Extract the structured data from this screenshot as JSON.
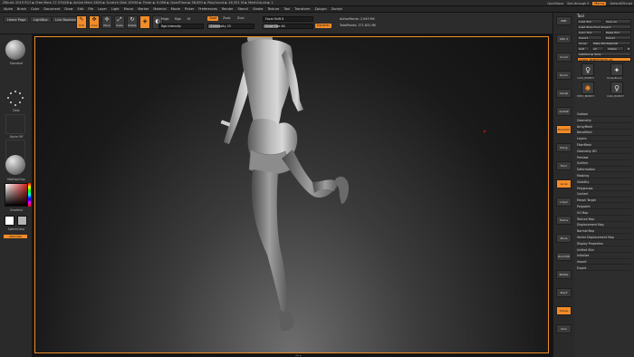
{
  "titlebar": {
    "title": "ZBrush 2019   R12   ► Free Mem 17.574GB ► Active Mem 2624 ► Scratch Disk 10934 ► Timer ► 0.066 ► QuadTime ► 58,891 ► PolyCount ► 16,351 M ► MeshCount ► 1",
    "items": [
      "QuickSave",
      "See-through 0",
      "Menus",
      "DefaultZScript"
    ]
  },
  "menubar": [
    "Alpha",
    "Brush",
    "Color",
    "Document",
    "Draw",
    "Edit",
    "File",
    "Layer",
    "Light",
    "Macro",
    "Marker",
    "Material",
    "Movie",
    "Picker",
    "Preferences",
    "Render",
    "Stencil",
    "Stroke",
    "Texture",
    "Tool",
    "Transform",
    "Zplugin",
    "Zscript"
  ],
  "shelf": {
    "home_page": "Home Page",
    "lightbox": "LightBox",
    "live_boolean": "Live Boolean",
    "tools": [
      {
        "icon": "edit-icon",
        "glyph": "✎",
        "label": "Edit",
        "active": true
      },
      {
        "icon": "draw-icon",
        "glyph": "✥",
        "label": "Draw",
        "active": true
      },
      {
        "icon": "move-icon",
        "glyph": "✢",
        "label": "Move",
        "active": false
      },
      {
        "icon": "scale-icon",
        "glyph": "⤢",
        "label": "Scale",
        "active": false
      },
      {
        "icon": "rotate-icon",
        "glyph": "↻",
        "label": "Rotate",
        "active": false
      },
      {
        "icon": "gizmo-icon",
        "glyph": "◈",
        "label": "",
        "active": true
      },
      {
        "icon": "sphere-icon",
        "glyph": "◐",
        "label": "",
        "active": false
      }
    ],
    "mrgb": "Mrgb",
    "rgb": "Rgb",
    "m": "M",
    "zadd": "Zadd",
    "zsub": "Zsub",
    "zcut": "Zcut",
    "rgb_intensity": "Rgb Intensity",
    "z_intensity": "Z Intensity 25",
    "z_intensity_value": 0.25,
    "focal_shift": "Focal Shift 0",
    "draw_size": "Draw Size 64",
    "active_points": "ActivePoints: 2,949 Mil",
    "total_points": "TotalPoints: 271.831 Mil",
    "dynamic": "Dynamic"
  },
  "leftpanel": {
    "standard": "Standard",
    "dots": "Dots",
    "alpha_off": "Alpha Off",
    "texture_off": "Texture Off",
    "matcap": "MatCapGray",
    "gradient": "Gradient",
    "switch_color": "SwitchColor",
    "alternate": "Alternate",
    "fg_color": "#ffffff",
    "bg_color": "#b4b4b4"
  },
  "canvas": {
    "footer": "◂ ▸ ▴"
  },
  "right_strip": [
    {
      "label": "BPR",
      "orange": false
    },
    {
      "label": "SPix 3",
      "orange": false
    },
    {
      "label": "Scroll",
      "orange": false
    },
    {
      "label": "Zoom",
      "orange": false
    },
    {
      "label": "Actual",
      "orange": false
    },
    {
      "label": "AAHalf",
      "orange": false
    },
    {
      "label": "Dynamic",
      "orange": true
    },
    {
      "label": "Persp",
      "orange": false
    },
    {
      "label": "Floor",
      "orange": false
    },
    {
      "label": "Local",
      "orange": true
    },
    {
      "label": "L.Sym",
      "orange": false
    },
    {
      "label": "Frame",
      "orange": false
    },
    {
      "label": "Move",
      "orange": false
    },
    {
      "label": "Zoom3D",
      "orange": false
    },
    {
      "label": "Rotate",
      "orange": false
    },
    {
      "label": "PolyF",
      "orange": false
    },
    {
      "label": "Transp",
      "orange": true
    },
    {
      "label": "Solo",
      "orange": false
    }
  ],
  "rightpanel": {
    "title": "Tool",
    "buttons": [
      "Load Tool",
      "Save As",
      "Load Tools From Project",
      "Copy Tool",
      "Paste Tool",
      "Import",
      "Export",
      "Clone",
      "Make PolyMesh3D",
      "GoZ",
      "All",
      "Visible",
      "R",
      "Lightbox ► Tools",
      "CLOGS_BKNEXTNCHG 48"
    ],
    "thumbs": [
      {
        "glyph": "♀",
        "label": "CLOD_BKNEXT"
      },
      {
        "glyph": "✦",
        "label": "SimpleBrush"
      },
      {
        "glyph": "✺",
        "label": "PM3D_BKNEXT"
      },
      {
        "glyph": "♀",
        "label": "CLOG_BKNEXT"
      }
    ],
    "subpalettes": [
      "Subtool",
      "Geometry",
      "ArrayMesh",
      "NanoMesh",
      "Layers",
      "FiberMesh",
      "Geometry HD",
      "Preview",
      "Surface",
      "Deformation",
      "Masking",
      "Visibility",
      "Polygroups",
      "Contact",
      "Morph Target",
      "Polypaint",
      "UV Map",
      "Texture Map",
      "Displacement Map",
      "Normal Map",
      "Vector Displacement Map",
      "Display Properties",
      "Unified Skin",
      "Initialize",
      "Import",
      "Export"
    ]
  },
  "colors": {
    "accent": "#f28c28",
    "panel": "#2d2d2d",
    "canvas_border": "#f28c28"
  }
}
